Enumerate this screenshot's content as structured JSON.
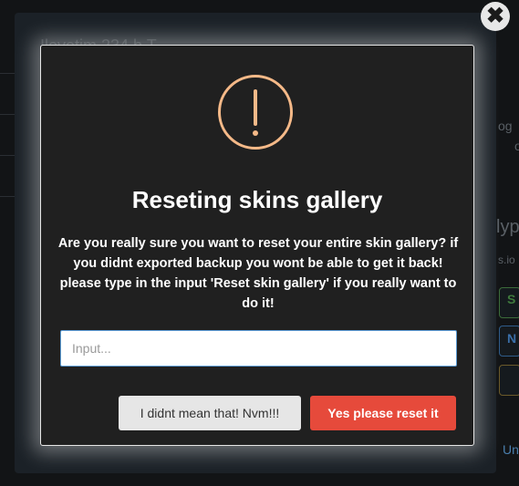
{
  "background": {
    "title": "Ilovetim 234 b T...",
    "fragments": [
      "og",
      "o",
      "lyp",
      "s.io",
      "S",
      "N",
      "Un"
    ]
  },
  "close": {
    "icon": "close-icon"
  },
  "modal": {
    "icon": "exclamation-circle-icon",
    "icon_color": "#f5b988",
    "title": "Reseting skins gallery",
    "message": "Are you really sure you want to reset your entire skin gallery? if you didnt exported backup you wont be able to get it back! please type in the input 'Reset skin gallery' if you really want to do it!",
    "input_placeholder": "Input...",
    "input_value": "",
    "cancel_label": "I didnt mean that! Nvm!!!",
    "confirm_label": "Yes please reset it",
    "confirm_color": "#e64a3b"
  }
}
